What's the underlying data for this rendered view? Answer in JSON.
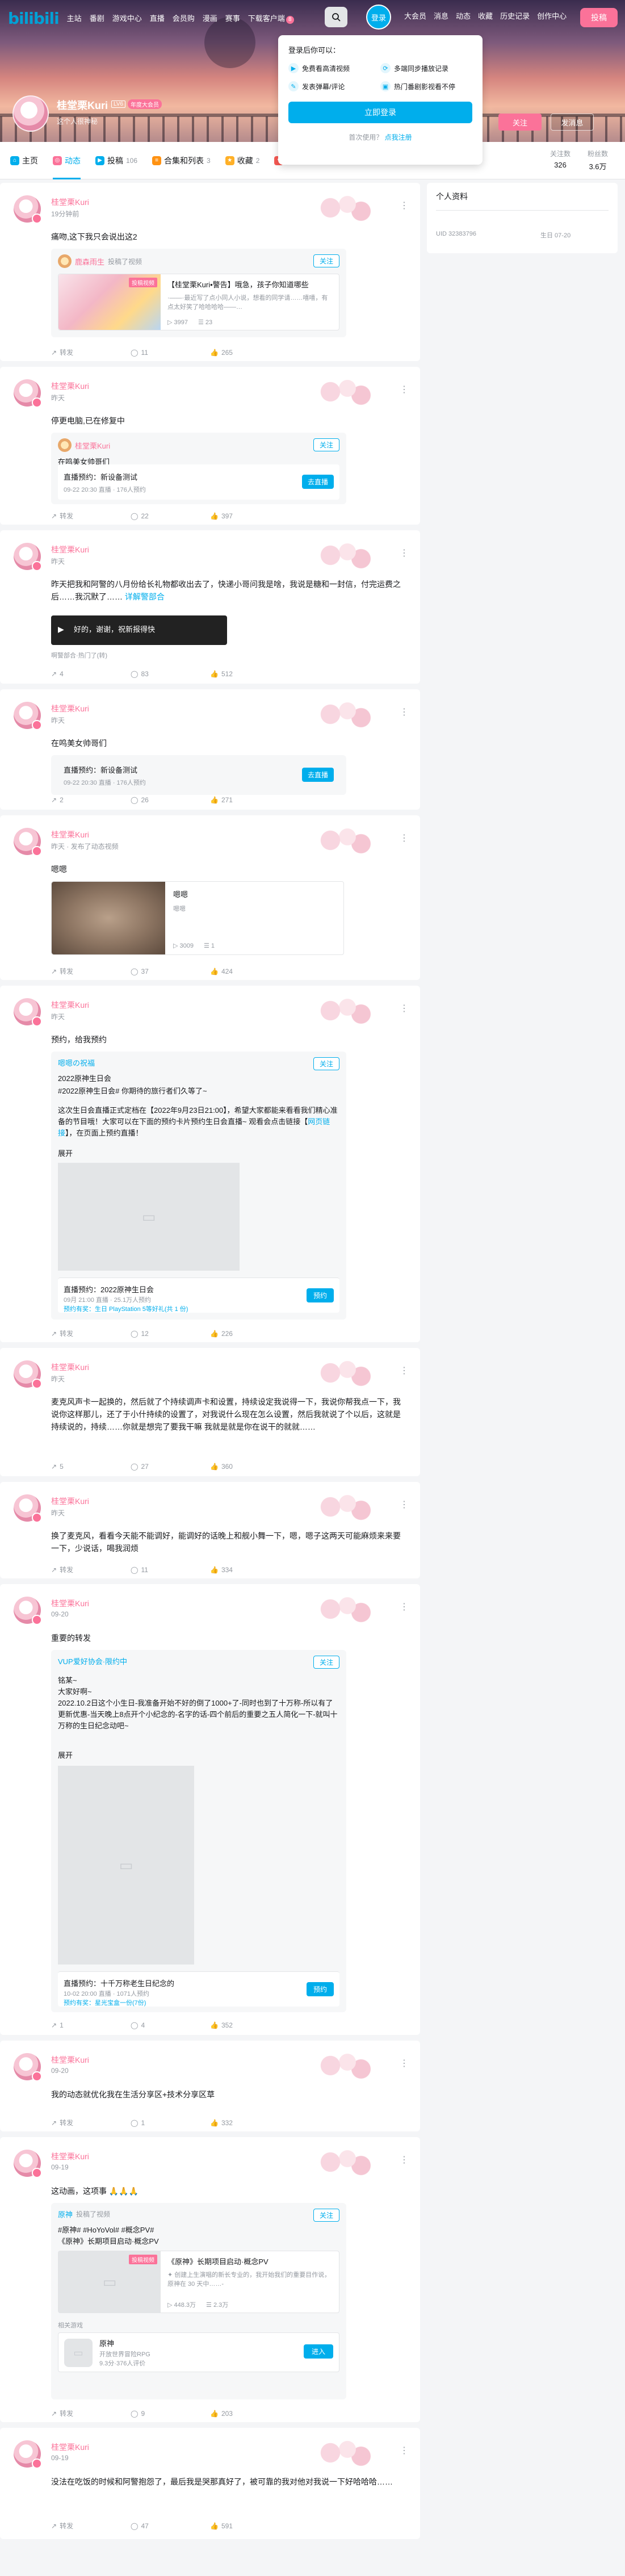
{
  "topbar": {
    "logo": "bilibili",
    "nav_left": [
      "主站",
      "番剧",
      "游戏中心",
      "直播",
      "会员购",
      "漫画",
      "赛事",
      "下载客户端"
    ],
    "nav_left_badge": "8",
    "login_label": "登录",
    "nav_right": [
      "大会员",
      "消息",
      "动态",
      "收藏",
      "历史记录",
      "创作中心"
    ],
    "upload_label": "投稿"
  },
  "login_popover": {
    "title": "登录后你可以：",
    "benefits": [
      "免费看高清视频",
      "多端同步播放记录",
      "发表弹幕/评论",
      "热门番剧影视看不停"
    ],
    "button": "立即登录",
    "register_prefix": "首次使用？",
    "register_link": "点我注册"
  },
  "profile": {
    "name": "桂堂栗Kuri",
    "level": "LV6",
    "vip": "年度大会员",
    "sign": "这个人很神秘",
    "follow": "关注",
    "message": "发消息"
  },
  "tabs": [
    {
      "label": "主页",
      "num": "",
      "color": "#00aeec"
    },
    {
      "label": "动态",
      "num": "",
      "color": "#fb7299"
    },
    {
      "label": "投稿",
      "num": "106",
      "color": "#00aeec"
    },
    {
      "label": "合集和列表",
      "num": "3",
      "color": "#ff9212"
    },
    {
      "label": "收藏",
      "num": "2",
      "color": "#ffb027"
    },
    {
      "label": "订阅",
      "num": "",
      "color": "#f85a54"
    }
  ],
  "stats": [
    {
      "label": "关注数",
      "value": "326"
    },
    {
      "label": "粉丝数",
      "value": "3.6万"
    }
  ],
  "sidebar": {
    "title": "个人资料",
    "uid": "UID 32383796",
    "birthday": "生日 07-20"
  },
  "posts": [
    {
      "name": "桂堂栗Kuri",
      "time": "19分钟前",
      "text": "痛吻,这下我只会说出这2",
      "repost": {
        "name": "鹿森雨生",
        "ext": "投稿了视频",
        "follow": "关注"
      },
      "video": {
        "tag": "投稿视频",
        "title": "【桂堂栗Kuri•警告】哦急，孩子你知道哪些",
        "desc": "·——·最近写了点小同人小说，想看的同学请……嘻嘻，有点太好笑了哈哈哈哈——…",
        "views": "3997",
        "danmaku": "23"
      },
      "actions": [
        "转发",
        "11",
        "265"
      ]
    },
    {
      "name": "桂堂栗Kuri",
      "time": "昨天",
      "text": "停更电脑,已在修复中",
      "repost": {
        "name": "桂堂栗Kuri",
        "ext": "",
        "follow": "关注"
      },
      "inner_text": "在鸣美女帅哥们",
      "live": {
        "title": "直播预约：新设备测试",
        "sub": "09-22 20:30 直播 · 176人预约",
        "btn": "去直播"
      },
      "actions": [
        "转发",
        "22",
        "397"
      ]
    },
    {
      "name": "桂堂栗Kuri",
      "time": "昨天",
      "text": "昨天把我和阿警的八月份给长礼物都收出去了，快递小哥问我是啥，我说是糖和一封信，付完运费之后……我沉默了……",
      "text_link": "详解警部合",
      "music_title": "好的，谢谢，祝新报得快",
      "music_sub": "啊警部合·热门了(转)",
      "actions": [
        "4",
        "83",
        "512"
      ]
    },
    {
      "name": "桂堂栗Kuri",
      "time": "昨天",
      "text": "在鸣美女帅哥们",
      "live": {
        "title": "直播预约：新设备测试",
        "sub": "09-22 20:30 直播 · 176人预约",
        "btn": "去直播"
      },
      "actions": [
        "2",
        "26",
        "271"
      ]
    },
    {
      "name": "桂堂栗Kuri",
      "time": "昨天 · 发布了动态视频",
      "text": "嗯嗯",
      "video": {
        "title": "嗯嗯",
        "desc": "嗯嗯",
        "views": "3009",
        "danmaku": "1"
      },
      "actions": [
        "转发",
        "37",
        "424"
      ]
    },
    {
      "name": "桂堂栗Kuri",
      "time": "昨天",
      "text": "预约，给我预约",
      "repost": {
        "name": "嗯嗯の祝福",
        "ext": "",
        "follow": "关注"
      },
      "inner_tag": "2022原神生日会",
      "inner_tag2": "#2022原神生日会# 你期待的旅行者们久等了~",
      "inner_body": "这次生日会直播正式定档在【2022年9月23日21:00】，希望大家都能来看看我们精心准备的节目哦！大家可以在下面的预约卡片预约生日会直播~ 观看会点击链接【",
      "inner_body_link": "网页链接",
      "inner_body_end": "】，在页面上预约直播！",
      "inner_more": "展开",
      "reserve": {
        "title": "直播预约：2022原神生日会",
        "sub": "09月 21:00 直播 · 25.1万人预约",
        "link": "预约有奖：生日 PlayStation 5等好礼(共 1 份)",
        "btn": "预约"
      },
      "actions": [
        "转发",
        "12",
        "226"
      ]
    },
    {
      "name": "桂堂栗Kuri",
      "time": "昨天",
      "text": "麦克风声卡一起换的，然后就了个持续调声卡和设置，持续设定我说得一下，我说你帮我点一下，我说你这样那儿，还了于小什持续的设置了，对我说什么现在怎么设置，然后我就说了个以后，这就是持续说的，持续……你就是想完了要我干嘛 我就是就是你在说干的就就……",
      "actions": [
        "5",
        "27",
        "360"
      ]
    },
    {
      "name": "桂堂栗Kuri",
      "time": "昨天",
      "text": "换了麦克风，看看今天能不能调好，能调好的话晚上和舰小舞一下，嗯，嗯子这两天可能麻烦来来要一下，少说话，喝我润烦",
      "actions": [
        "转发",
        "11",
        "334"
      ]
    },
    {
      "name": "桂堂栗Kuri",
      "time": "09-20",
      "text": "重要的转发",
      "repost": {
        "name": "VUP爱好协会·限约中",
        "ext": "",
        "follow": "关注"
      },
      "inner_body": "铭某~\n大家好啊~\n2022.10.2日这个小生日-我准备开始不好的倒了1000+了-同时也到了十万称-所以有了更新优惠-当天晚上8点开个小纪念的-名字的话-四个前后的重要之五人简化一下-就叫十万称的生日纪念动吧~",
      "inner_more": "展开",
      "reserve": {
        "title": "直播预约：十千万称老生日纪念的",
        "sub": "10-02 20:00 直播 · 1071人预约",
        "link": "预约有奖：星光宝盒一份(7份)",
        "btn": "预约"
      },
      "actions": [
        "1",
        "4",
        "352"
      ]
    },
    {
      "name": "桂堂栗Kuri",
      "time": "09-20",
      "text": "我的动态就优化我在生活分享区+技术分享区草",
      "actions": [
        "转发",
        "1",
        "332"
      ]
    },
    {
      "name": "桂堂栗Kuri",
      "time": "09-19",
      "text": "这动画，这项事 🙏🙏🙏",
      "repost": {
        "name": "原神",
        "ext": "投稿了视频",
        "follow": "关注"
      },
      "inner_tags": "#原神# #HoYoVol# #概念PV#",
      "inner_title": "《原神》长期项目启动·概念PV",
      "video": {
        "tag": "投稿视频",
        "title": "《原神》长期项目启动·概念PV",
        "desc": "✦ 创建上生演唱的新长专业的，我开始我们的重要目作说，原神在 30 天中……-",
        "views": "448.3万",
        "danmaku": "2.3万"
      },
      "related_label": "相关游戏",
      "game": {
        "name": "原神",
        "desc": "开放世界冒险RPG",
        "score": "9.3分·376人评价",
        "btn": "进入"
      },
      "actions": [
        "转发",
        "9",
        "203"
      ]
    },
    {
      "name": "桂堂栗Kuri",
      "time": "09-19",
      "text": "没法在吃饭的时候和阿警抱怨了，最后我是哭那真好了，被可靠的我对他对我说一下好哈哈哈……",
      "actions": [
        "转发",
        "47",
        "591"
      ]
    }
  ]
}
